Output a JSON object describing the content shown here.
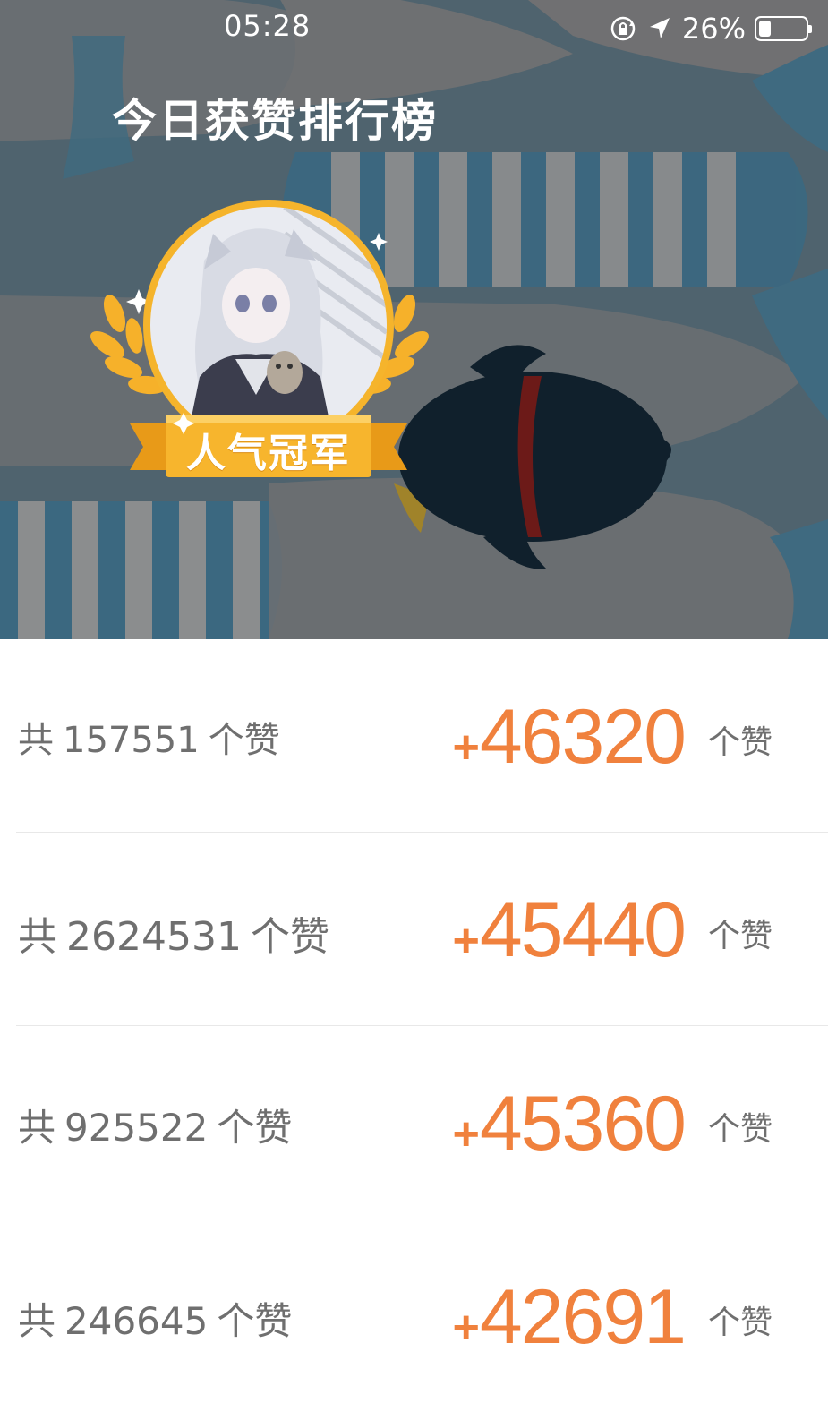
{
  "status_bar": {
    "time": "05:28",
    "battery_percent_text": "26%",
    "battery_level": 0.26,
    "icons": [
      "orientation-lock-icon",
      "location-arrow-icon",
      "battery-icon"
    ]
  },
  "header": {
    "title": "今日获赞排行榜"
  },
  "champion": {
    "badge_label": "人气冠军"
  },
  "colors": {
    "accent": "#f0813d",
    "gold": "#f5b42c",
    "banner": "#4f636e",
    "text_muted": "#6f6f6f"
  },
  "ranking": [
    {
      "prefix": "共",
      "total": "157551",
      "unit": "个赞",
      "gain": "+46320",
      "gain_plus": "+",
      "gain_value": "46320",
      "gain_unit": "个赞"
    },
    {
      "prefix": "共",
      "total": "2624531",
      "unit": "个赞",
      "gain": "+45440",
      "gain_plus": "+",
      "gain_value": "45440",
      "gain_unit": "个赞"
    },
    {
      "prefix": "共",
      "total": "925522",
      "unit": "个赞",
      "gain": "+45360",
      "gain_plus": "+",
      "gain_value": "45360",
      "gain_unit": "个赞"
    },
    {
      "prefix": "共",
      "total": "246645",
      "unit": "个赞",
      "gain": "+42691",
      "gain_plus": "+",
      "gain_value": "42691",
      "gain_unit": "个赞"
    }
  ]
}
